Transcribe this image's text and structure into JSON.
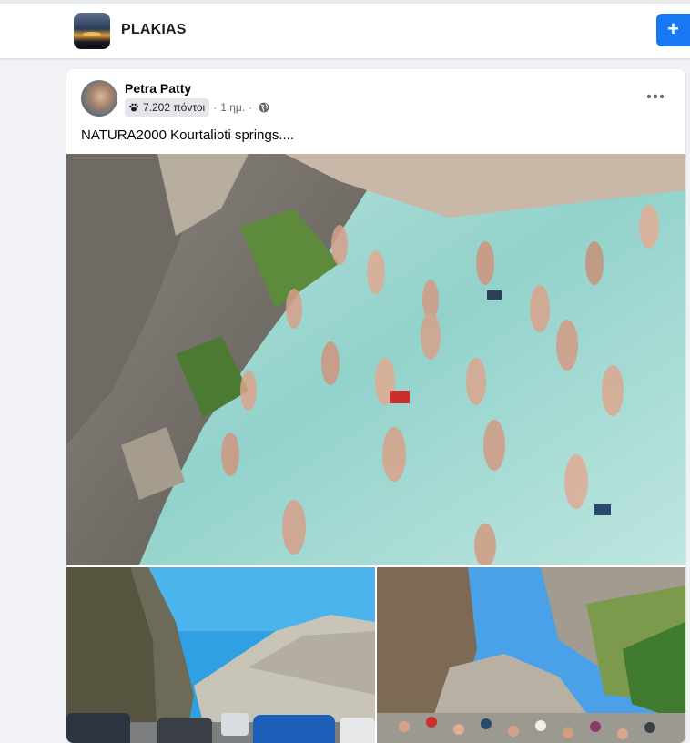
{
  "header": {
    "group_name": "PLAKIAS",
    "join_button_label": "+"
  },
  "post": {
    "author": "Petra Patty",
    "points_badge": "7.202 πόντοι",
    "separator": "·",
    "time": "1 ημ.",
    "privacy_icon": "globe-icon",
    "text": "NATURA2000 Kourtalioti springs....",
    "photos": [
      {
        "name": "crowded-springs-photo"
      },
      {
        "name": "parked-cars-road-photo"
      },
      {
        "name": "gorge-crowd-photo"
      }
    ]
  },
  "colors": {
    "accent": "#1877f2",
    "page_bg": "#f0f2f5",
    "water": "#9fd6cf"
  }
}
